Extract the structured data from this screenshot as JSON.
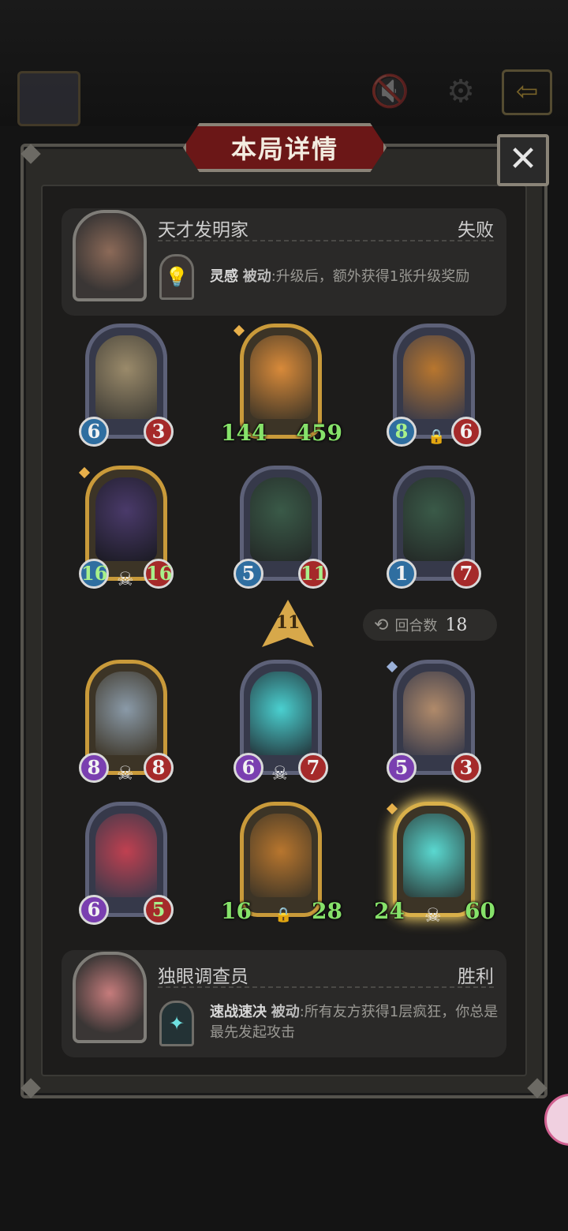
{
  "header": {
    "title": "本局详情",
    "close_icon": "✕",
    "mute_icon": "speaker-mute-icon",
    "settings_icon": "gear-icon",
    "exit_icon": "exit-icon"
  },
  "opponent": {
    "name": "天才发明家",
    "result": "失败",
    "skill_name": "灵感",
    "skill_type": "被动",
    "skill_desc": ":升级后，额外获得1张升级奖励"
  },
  "opponent_cards": [
    {
      "atk": "6",
      "hp": "3"
    },
    {
      "atk": "144",
      "hp": "459"
    },
    {
      "atk": "8",
      "hp": "6"
    },
    {
      "atk": "16",
      "hp": "16"
    },
    {
      "atk": "5",
      "hp": "11"
    },
    {
      "atk": "1",
      "hp": "7"
    }
  ],
  "turn": {
    "level": "11",
    "rounds_label": "回合数",
    "rounds_value": "18"
  },
  "player_cards": [
    {
      "atk": "8",
      "hp": "8"
    },
    {
      "atk": "6",
      "hp": "7"
    },
    {
      "atk": "5",
      "hp": "3"
    },
    {
      "atk": "6",
      "hp": "5"
    },
    {
      "atk": "16",
      "hp": "28"
    },
    {
      "atk": "24",
      "hp": "60"
    }
  ],
  "player": {
    "name": "独眼调查员",
    "result": "胜利",
    "skill_name": "速战速决",
    "skill_type": "被动",
    "skill_desc": ":所有友方获得1层疯狂，你总是最先发起攻击"
  }
}
